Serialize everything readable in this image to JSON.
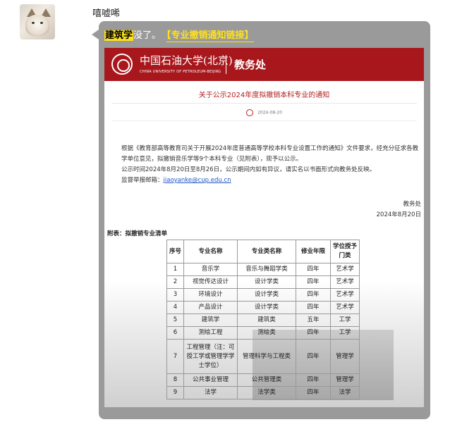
{
  "chat": {
    "sender_name": "嘻嘘唏",
    "message": {
      "highlight": "建筑学",
      "text": "没了。",
      "link_label": "【专业撤销通知链接】"
    }
  },
  "document": {
    "header": {
      "university_cn": "中国石油大学(北京)",
      "university_en": "CHINA UNIVERSITY OF PETROLEUM-BEIJING",
      "department": "教务处"
    },
    "title": "关于公示2024年度拟撤销本科专业的通知",
    "date": "2024-08-20",
    "paragraph1": "根据《教育部高等教育司关于开展2024年度普通高等学校本科专业设置工作的通知》文件要求，经充分征求各教学单位意见，拟撤销音乐学等9个本科专业（见附表），现予以公示。",
    "paragraph2": "公示时间2024年8月20日至8月26日，公示期间内如有异议，请实名以书面形式向教务处反映。",
    "report_label": "监督举报邮箱：",
    "report_email": "jiaoyanke@cup.edu.cn",
    "signature_org": "教务处",
    "signature_date": "2024年8月20日",
    "appendix_title": "附表：拟撤销专业清单",
    "table": {
      "headers": [
        "序号",
        "专业名称",
        "专业类名称",
        "修业年限",
        "学位授予门类"
      ],
      "rows": [
        [
          "1",
          "音乐学",
          "音乐与舞蹈学类",
          "四年",
          "艺术学"
        ],
        [
          "2",
          "视觉传达设计",
          "设计学类",
          "四年",
          "艺术学"
        ],
        [
          "3",
          "环境设计",
          "设计学类",
          "四年",
          "艺术学"
        ],
        [
          "4",
          "产品设计",
          "设计学类",
          "四年",
          "艺术学"
        ],
        [
          "5",
          "建筑学",
          "建筑类",
          "五年",
          "工学"
        ],
        [
          "6",
          "测绘工程",
          "测绘类",
          "四年",
          "工学"
        ],
        [
          "7",
          "工程管理（注：可授工学或管理学学士学位）",
          "管理科学与工程类",
          "四年",
          "管理学"
        ],
        [
          "8",
          "公共事业管理",
          "公共管理类",
          "四年",
          "管理学"
        ],
        [
          "9",
          "法学",
          "法学类",
          "四年",
          "法学"
        ]
      ]
    }
  },
  "colors": {
    "bubble": "#9a9a9a",
    "highlight": "#ffe11a",
    "banner": "#a8171c",
    "title": "#b41d1d",
    "link": "#1b56c6"
  },
  "icons": {
    "avatar": "cat-avatar",
    "logo": "university-seal-icon",
    "date": "clock-icon"
  }
}
